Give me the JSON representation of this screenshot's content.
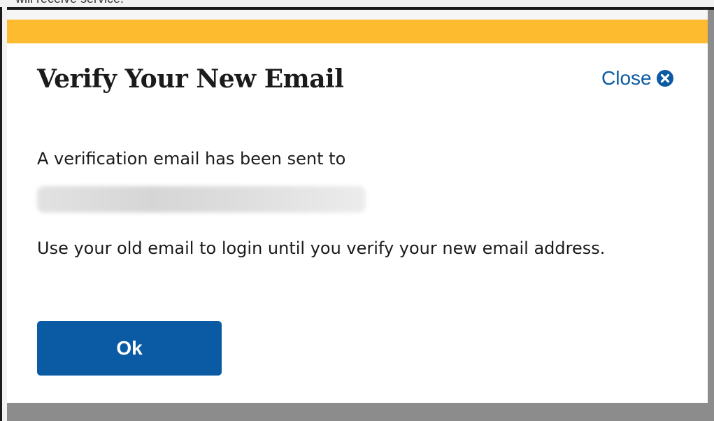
{
  "background": {
    "partial_text": "will receive service."
  },
  "modal": {
    "title": "Verify Your New Email",
    "close_label": "Close",
    "close_icon": "circle-x-icon",
    "message_sent": "A verification email has been sent to",
    "email_redacted": true,
    "message_old_email": "Use your old email to login until you verify your new email address.",
    "ok_label": "Ok"
  },
  "colors": {
    "accent": "#fdbb30",
    "primary": "#0b5aa4",
    "text": "#1b1b1b",
    "overlay": "#8a8a8a"
  }
}
